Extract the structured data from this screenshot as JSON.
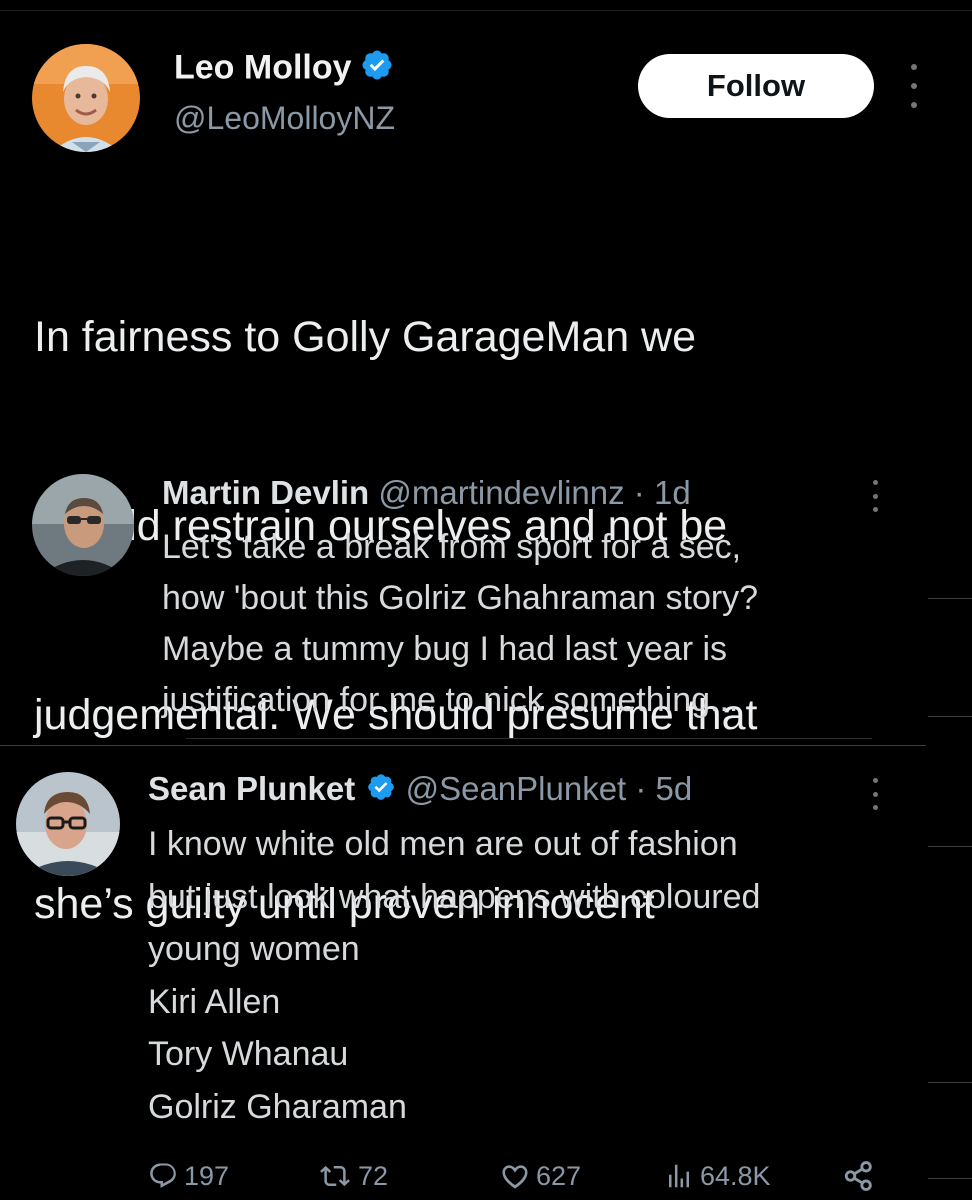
{
  "tweet": {
    "author": {
      "name": "Leo Molloy",
      "handle": "@LeoMolloyNZ",
      "verified": true
    },
    "follow_label": "Follow",
    "text_lines": [
      "In fairness to Golly GarageMan we",
      "should restrain ourselves and not be",
      "judgemental. We should presume that",
      "she’s guilty until proven innocent"
    ]
  },
  "embedded": [
    {
      "name": "Martin Devlin",
      "handle": "@martindevlinnz",
      "time": "1d",
      "separator": " · ",
      "verified": false,
      "text_lines": [
        "Let's take a break from sport for a sec,",
        "how 'bout this Golriz Ghahraman story?",
        "Maybe a tummy bug I had last year is",
        "justification for me to nick something..."
      ]
    },
    {
      "name": "Sean Plunket",
      "handle": "@SeanPlunket",
      "time": "5d",
      "separator": " · ",
      "verified": true,
      "text_lines": [
        "I know white old men are out of fashion",
        "but just look what happens with coloured",
        "young women",
        "Kiri Allen",
        "Tory Whanau",
        "Golriz Gharaman"
      ]
    }
  ],
  "actions": {
    "replies": "197",
    "retweets": "72",
    "likes": "627",
    "views": "64.8K"
  },
  "colors": {
    "background": "#000000",
    "verified_blue": "#1d9bf0",
    "muted_text": "#8b98a5",
    "follow_bg": "#ffffff"
  },
  "icons": [
    "verified-badge-icon",
    "more-options-icon",
    "reply-icon",
    "retweet-icon",
    "like-icon",
    "views-icon",
    "share-icon"
  ]
}
